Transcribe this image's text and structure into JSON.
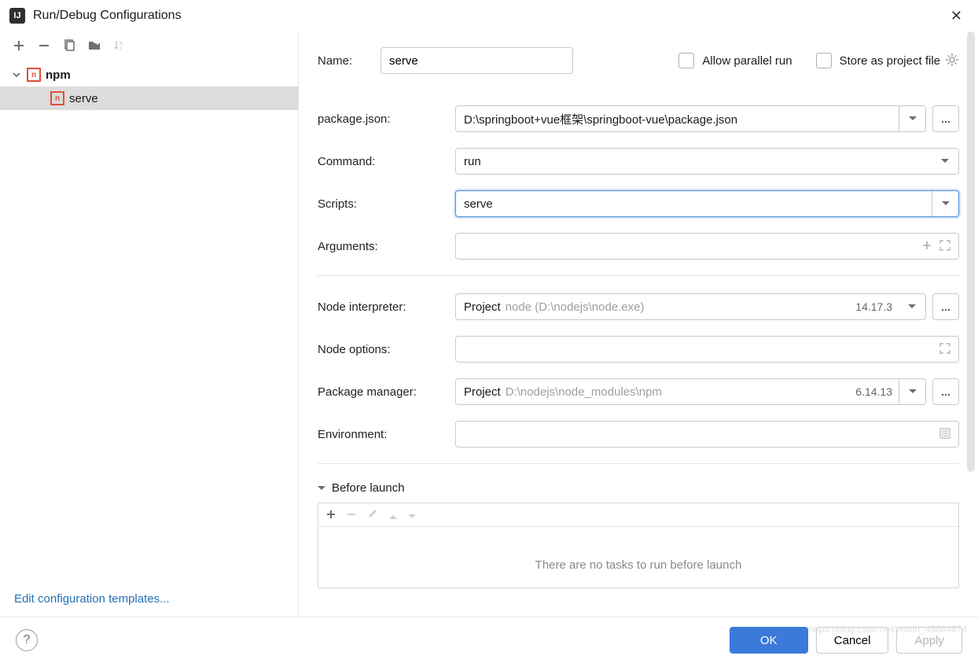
{
  "title": "Run/Debug Configurations",
  "tree": {
    "group": "npm",
    "child": "serve"
  },
  "editTemplates": "Edit configuration templates...",
  "form": {
    "nameLabel": "Name:",
    "nameValue": "serve",
    "allowParallel": "Allow parallel run",
    "storeAsProject": "Store as project file",
    "packageJsonLabel": "package.json:",
    "packageJsonValue": "D:\\springboot+vue框架\\springboot-vue\\package.json",
    "commandLabel": "Command:",
    "commandValue": "run",
    "scriptsLabel": "Scripts:",
    "scriptsValue": "serve",
    "argumentsLabel": "Arguments:",
    "argumentsValue": "",
    "nodeInterpLabel": "Node interpreter:",
    "nodeInterpPrefix": "Project",
    "nodeInterpHint": "node (D:\\nodejs\\node.exe)",
    "nodeInterpVersion": "14.17.3",
    "nodeOptionsLabel": "Node options:",
    "nodeOptionsValue": "",
    "pkgMgrLabel": "Package manager:",
    "pkgMgrPrefix": "Project",
    "pkgMgrHint": "D:\\nodejs\\node_modules\\npm",
    "pkgMgrVersion": "6.14.13",
    "envLabel": "Environment:",
    "envValue": ""
  },
  "beforeLaunch": {
    "title": "Before launch",
    "empty": "There are no tasks to run before launch"
  },
  "buttons": {
    "ok": "OK",
    "cancel": "Cancel",
    "apply": "Apply"
  },
  "watermark": "https://blog.csdn.net/veixin_45684674"
}
